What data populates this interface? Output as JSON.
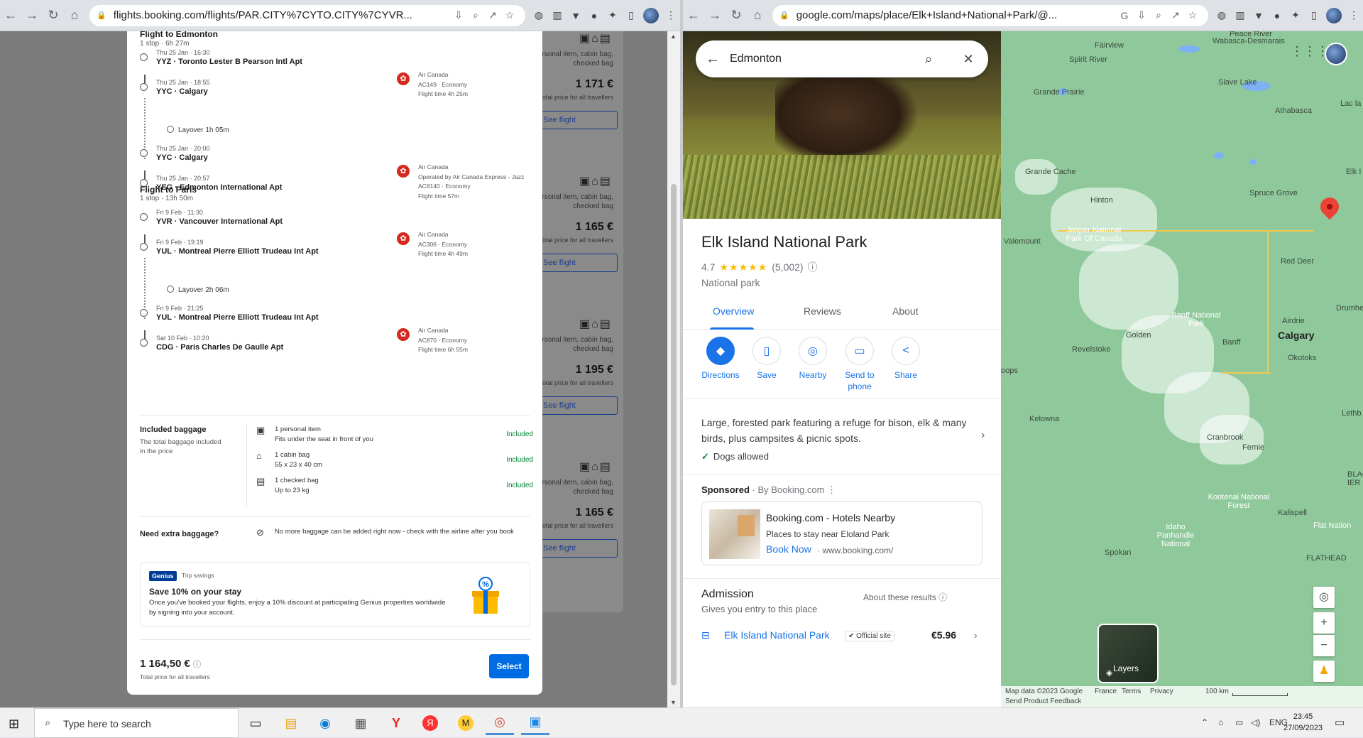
{
  "left_browser": {
    "url": "flights.booking.com/flights/PAR.CITY%7CYTO.CITY%7CYVR..."
  },
  "right_browser": {
    "url": "google.com/maps/place/Elk+Island+National+Park/@..."
  },
  "flight_detail": {
    "outbound": {
      "title": "Flight to Edmonton",
      "summary": "1 stop · 6h 27m",
      "stops": [
        {
          "date": "Thu 25 Jan · 16:30",
          "place": "YYZ · Toronto Lester B Pearson Intl Apt"
        },
        {
          "date": "Thu 25 Jan · 18:55",
          "place": "YYC · Calgary"
        },
        {
          "date": "Thu 25 Jan · 20:00",
          "place": "YYC · Calgary"
        },
        {
          "date": "Thu 25 Jan · 20:57",
          "place": "YEG · Edmonton International Apt"
        }
      ],
      "layover": "Layover 1h 05m",
      "segments": [
        {
          "lines": [
            "Air Canada",
            "AC149 · Economy",
            "Flight time 4h 25m"
          ]
        },
        {
          "lines": [
            "Air Canada",
            "Operated by Air Canada Express - Jazz",
            "AC8140 · Economy",
            "Flight time 57m"
          ]
        }
      ]
    },
    "return": {
      "title": "Flight to Paris",
      "summary": "1 stop · 13h 50m",
      "stops": [
        {
          "date": "Fri 9 Feb · 11:30",
          "place": "YVR · Vancouver International Apt"
        },
        {
          "date": "Fri 9 Feb · 19:19",
          "place": "YUL · Montreal Pierre Elliott Trudeau Int Apt"
        },
        {
          "date": "Fri 9 Feb · 21:25",
          "place": "YUL · Montreal Pierre Elliott Trudeau Int Apt"
        },
        {
          "date": "Sat 10 Feb · 10:20",
          "place": "CDG · Paris Charles De Gaulle Apt"
        }
      ],
      "layover": "Layover 2h 06m",
      "segments": [
        {
          "lines": [
            "Air Canada",
            "AC306 · Economy",
            "Flight time 4h 49m"
          ]
        },
        {
          "lines": [
            "Air Canada",
            "AC870 · Economy",
            "Flight time 6h 55m"
          ]
        }
      ]
    },
    "baggage": {
      "title": "Included baggage",
      "desc": "The total baggage included in the price",
      "items": [
        {
          "icon": "personal-item-icon",
          "glyph": "▣",
          "name": "1 personal item",
          "detail": "Fits under the seat in front of you",
          "status": "Included"
        },
        {
          "icon": "cabin-bag-icon",
          "glyph": "⌂",
          "name": "1 cabin bag",
          "detail": "55 x 23 x 40 cm",
          "status": "Included"
        },
        {
          "icon": "checked-bag-icon",
          "glyph": "▤",
          "name": "1 checked bag",
          "detail": "Up to 23 kg",
          "status": "Included"
        }
      ],
      "extra_title": "Need extra baggage?",
      "extra_desc": "No more baggage can be added right now - check with the airline after you book"
    },
    "genius": {
      "badge": "Genius",
      "tag": "Trip savings",
      "title": "Save 10% on your stay",
      "desc": "Once you've booked your flights, enjoy a 10% discount at participating Genius properties worldwide by signing into your account."
    },
    "price": "1 164,50 €",
    "price_sub": "Total price for all travellers",
    "select_label": "Select"
  },
  "bg_results": [
    {
      "price": "1 171 €"
    },
    {
      "price": "1 165 €"
    },
    {
      "price": "1 195 €"
    },
    {
      "price": "1 165 €"
    }
  ],
  "bg_common": {
    "bags": "personal item, cabin bag, checked bag",
    "sub": "Total price for all travellers",
    "btn": "See flight"
  },
  "maps": {
    "search_query": "Edmonton",
    "place": {
      "name": "Elk Island National Park",
      "rating": "4.7",
      "stars": "★★★★★",
      "reviews": "(5,002)",
      "type": "National park"
    },
    "tabs": [
      "Overview",
      "Reviews",
      "About"
    ],
    "actions": [
      {
        "label": "Directions",
        "glyph": "◆"
      },
      {
        "label": "Save",
        "glyph": "▯"
      },
      {
        "label": "Nearby",
        "glyph": "◎"
      },
      {
        "label": "Send to phone",
        "glyph": "▭"
      },
      {
        "label": "Share",
        "glyph": "<"
      }
    ],
    "description": "Large, forested park featuring a refuge for bison, elk & many birds, plus campsites & picnic spots.",
    "dogs": "Dogs allowed",
    "sponsored": {
      "label": "Sponsored",
      "by": "· By Booking.com"
    },
    "ad": {
      "title": "Booking.com - Hotels Nearby",
      "sub": "Places to stay near Eloland Park",
      "cta": "Book Now",
      "url": "· www.booking.com/"
    },
    "admission": {
      "title": "Admission",
      "sub": "Gives you entry to this place",
      "about": "About these results",
      "row_name": "Elk Island National Park",
      "official": "Official site",
      "price": "€5.96"
    },
    "map_labels": {
      "fairview": "Fairview",
      "spirit": "Spirit River",
      "peace": "Peace River",
      "wabasca": "Wabasca-Desmarais",
      "slave": "Slave Lake",
      "gprairie": "Grande Prairie",
      "athabasca": "Athabasca",
      "lac": "Lac la",
      "gcache": "Grande Cache",
      "elk": "Elk I",
      "spruce": "Spruce Grove",
      "hinton": "Hinton",
      "jasper": "Jasper National Park Of Canada",
      "valemount": "Valemount",
      "reddeer": "Red Deer",
      "drumhe": "Drumhe",
      "banff": "Banff National Park",
      "airdrie": "Airdrie",
      "calgary": "Calgary",
      "golden": "Golden",
      "revelstoke": "Revelstoke",
      "banfft": "Banff",
      "okotoks": "Okotoks",
      "oops": "oops",
      "kelowna": "Kelowna",
      "cranbrook": "Cranbrook",
      "fernie": "Fernie",
      "lethb": "Lethb",
      "kootenai": "Kootenai National Forest",
      "kalispell": "Kalispell",
      "flat": "Flat Nation",
      "idaho": "Idaho Panhandle National",
      "spokane": "Spokan",
      "flathead": "FLATHEAD",
      "black": "BLAC IER"
    },
    "layers": "Layers",
    "footer": {
      "mapdata": "Map data ©2023 Google",
      "france": "France",
      "terms": "Terms",
      "privacy": "Privacy",
      "feedback": "Send Product Feedback",
      "scale": "100 km"
    }
  },
  "taskbar": {
    "search": "Type here to search",
    "lang": "ENG",
    "time": "23:45",
    "date": "27/09/2023"
  }
}
